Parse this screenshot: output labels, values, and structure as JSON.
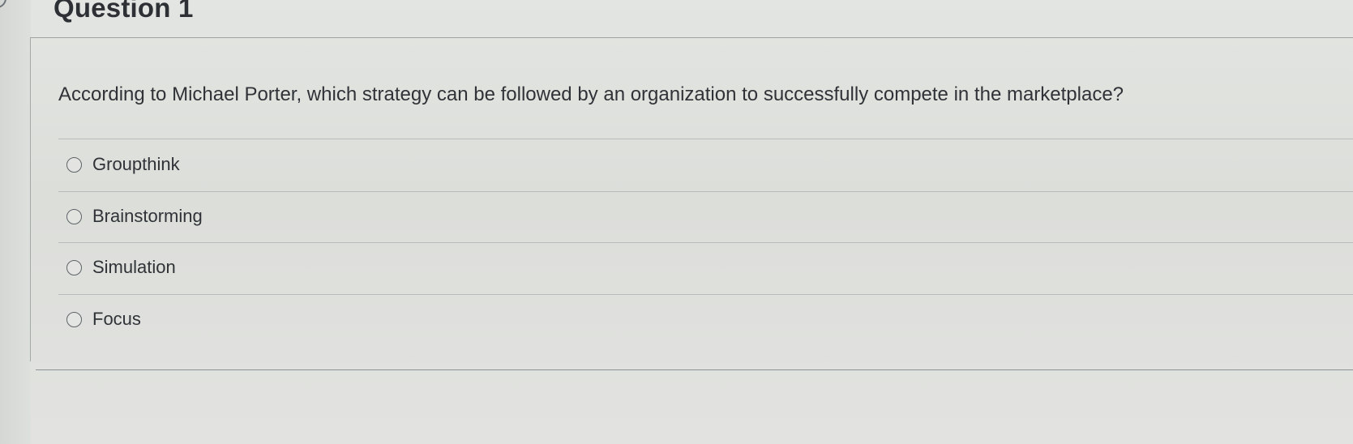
{
  "question": {
    "title": "Question 1",
    "prompt": "According to Michael Porter, which strategy can be followed by an organization to successfully compete in the marketplace?",
    "options": [
      {
        "label": "Groupthink",
        "selected": false
      },
      {
        "label": "Brainstorming",
        "selected": false
      },
      {
        "label": "Simulation",
        "selected": false
      },
      {
        "label": "Focus",
        "selected": false
      }
    ]
  }
}
